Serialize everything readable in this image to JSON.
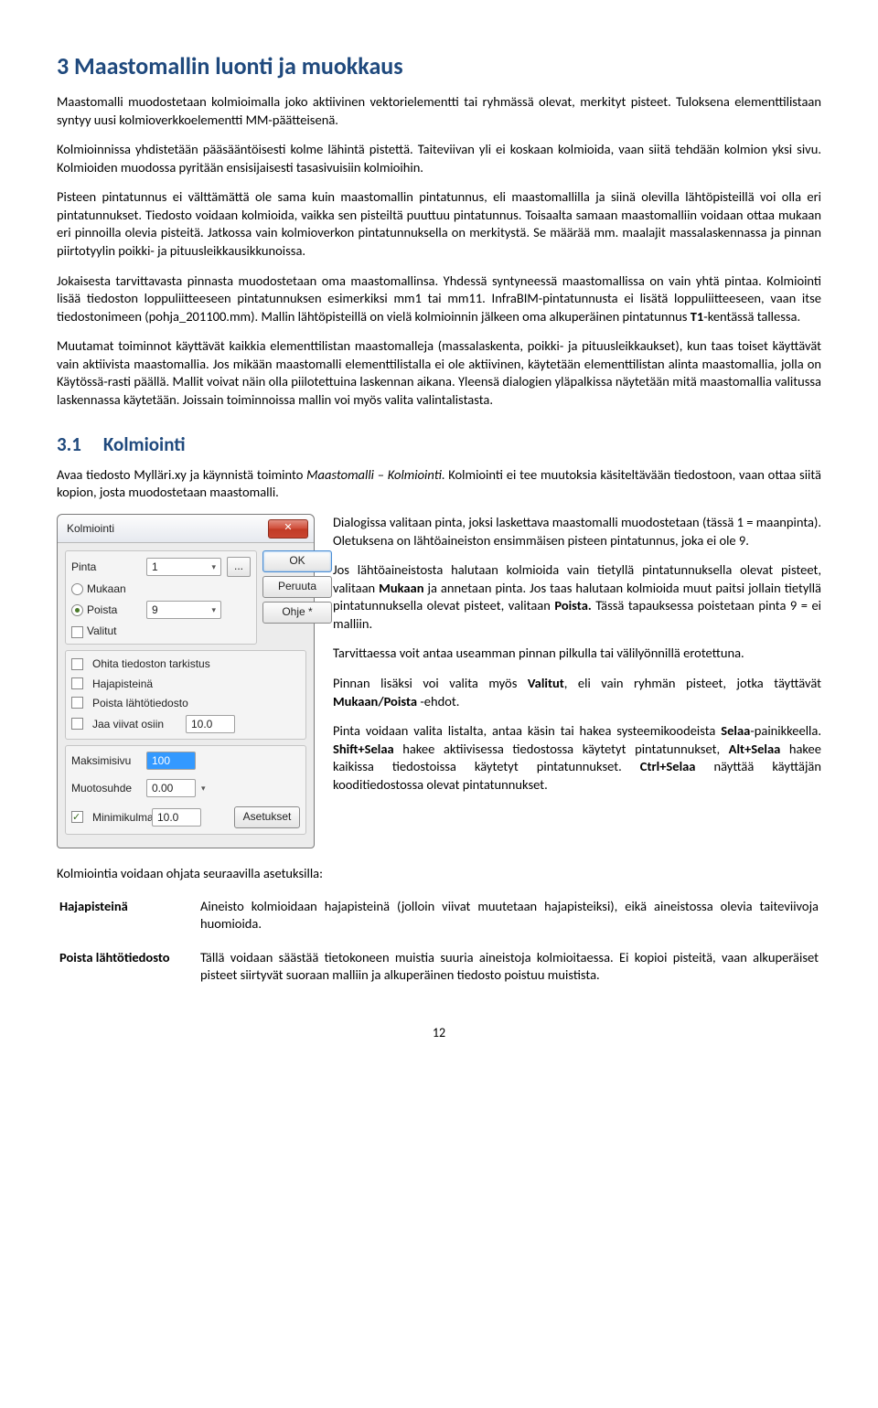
{
  "pageNumber": "12",
  "h1": "3   Maastomallin luonti ja muokkaus",
  "p1": "Maastomalli muodostetaan kolmioimalla joko aktiivinen vektorielementti tai ryhmässä olevat, merkityt pisteet. Tuloksena elementtilistaan syntyy uusi kolmioverkkoelementti MM-päätteisenä.",
  "p2a": "Kolmioinnissa yhdistetään pääsääntöisesti kolme lähintä pistettä. Taiteviivan yli ei koskaan kolmioida, vaan siitä tehdään kolmion yksi sivu. ",
  "p2b": "Kolmioiden muodossa pyritään ensisijaisesti tasasivuisiin kolmioihin.",
  "p3": "Pisteen pintatunnus ei välttämättä ole sama kuin maastomallin pintatunnus, eli maastomallilla ja siinä olevilla lähtöpisteillä voi olla eri pintatunnukset. Tiedosto voidaan kolmioida, vaikka sen pisteiltä puuttuu pintatunnus. Toisaalta samaan maastomalliin voidaan ottaa mukaan eri pinnoilla olevia pisteitä. Jatkossa vain kolmioverkon pintatunnuksella on merkitystä. Se määrää mm. maalajit massalaskennassa ja pinnan piirtotyylin poikki- ja pituus­leikkausikkunoissa.",
  "p4a": "Jokaisesta tarvittavasta pinnasta muodostetaan oma maastomallinsa. Yhdessä syntyneessä maastomallissa on vain yhtä pintaa. Kolmiointi lisää tiedoston loppuliitteeseen pintatunnuksen esimerkiksi mm1 tai mm11. InfraBIM-pintatunnusta ei lisätä loppuliitteeseen, vaan itse tiedostonimeen (pohja_201100.mm). Mallin lähtöpisteillä on vielä kolmioinnin jälkeen oma alkuperäinen pintatunnus ",
  "p4b": "T1",
  "p4c": "-kentässä tallessa.",
  "p5": "Muutamat toiminnot käyttävät kaikkia elementtilistan maastomalleja (massalaskenta, poikki- ja pituusleikkaukset), kun taas toiset käyttävät vain aktiivista maastomallia. Jos mikään maastomalli elementtilistalla ei ole aktiivinen, käytetään elementtilistan alinta maastomallia, jolla on Käytössä-rasti päällä. Mallit voivat näin olla piilotettuina laskennan aikana. Yleensä dialogien yläpalkissa näytetään mitä maastomallia valitussa laskennassa käytetään. Joissain toiminnoissa mallin voi myös valita valintalistasta.",
  "h2num": "3.1",
  "h2": "Kolmiointi",
  "p6a": "Avaa tiedosto Mylläri.xy ja käynnistä toiminto ",
  "p6b": "Maastomalli – Kolmiointi",
  "p6c": ". Kolmiointi ei tee muutoksia käsiteltävään tiedostoon, vaan ottaa siitä kopion, josta muodostetaan maastomalli.",
  "dialog": {
    "title": "Kolmiointi",
    "close": "✕",
    "pintaLabel": "Pinta",
    "pintaValue": "1",
    "browse": "...",
    "mukaan": "Mukaan",
    "poista": "Poista",
    "poistaValue": "9",
    "valitut": "Valitut",
    "ok": "OK",
    "peruuta": "Peruuta",
    "ohje": "Ohje *",
    "ohitaTarkistus": "Ohita tiedoston tarkistus",
    "hajapisteina": "Hajapisteinä",
    "poistaLahto": "Poista lähtötiedosto",
    "jaaViivat": "Jaa viivat osiin",
    "jaaViivatVal": "10.0",
    "maksimisivu": "Maksimisivu",
    "maksimisivuVal": "100",
    "muotosuhde": "Muotosuhde",
    "muotosuhdeVal": "0.00",
    "minimikulma": "Minimikulma",
    "minimikulmaVal": "10.0",
    "asetukset": "Asetukset"
  },
  "dp1": "Dialogissa valitaan pinta, joksi laskettava maastomalli muodostetaan (tässä 1 = maanpinta). Oletuksena on lähtö­aineiston ensimmäisen pisteen pintatunnus, joka ei ole 9.",
  "dp2a": "Jos lähtöaineistosta halutaan kolmioida vain tietyllä pinta­tunnuksella olevat pisteet, valitaan ",
  "dp2b": "Mukaan",
  "dp2c": " ja annetaan pinta. Jos taas halutaan kolmioida muut paitsi jollain tietyllä pinta­tunnuksella olevat pisteet, valitaan ",
  "dp2d": "Poista.",
  "dp2e": " Tässä tapauksessa poistetaan pinta 9 = ei malliin.",
  "dp3": "Tarvittaessa voit antaa useamman pinnan pilkulla tai väli­lyönnillä erotettuna.",
  "dp4a": "Pinnan lisäksi voi valita myös ",
  "dp4b": "Valitut",
  "dp4c": ", eli vain ryhmän pisteet, jotka täyttävät ",
  "dp4d": "Mukaan/Poista",
  "dp4e": " -ehdot.",
  "dp5a": "Pinta voidaan valita listalta, antaa käsin tai hakea systeemi­koodeista ",
  "dp5b": "Selaa",
  "dp5c": "-painikkeella. ",
  "dp5d": "Shift+Selaa",
  "dp5e": " hakee aktiivisessa tiedostossa käytetyt pintatunnukset, ",
  "dp5f": "Alt+Selaa",
  "dp5g": " hakee kaikissa tiedostoissa käytetyt pintatunnukset. ",
  "dp5h": "Ctrl+Selaa",
  "dp5i": " näyttää käyttäjän kooditiedostossa olevat pintatunnukset.",
  "settingsIntro": "Kolmiointia voidaan ohjata seuraavilla asetuksilla:",
  "settings": {
    "hajaLabel": "Hajapisteinä",
    "hajaDesc": "Aineisto kolmioidaan hajapisteinä (jolloin viivat muutetaan hajapisteiksi), eikä aineistossa olevia taiteviivoja huomioida.",
    "poistaLabel": "Poista lähtötiedosto",
    "poistaDesc": "Tällä voidaan säästää tietokoneen muistia suuria aineistoja kolmioitaessa. Ei kopioi pisteitä, vaan alkuperäiset pisteet siirtyvät suoraan malliin ja alkuperäinen tiedosto poistuu muistista."
  }
}
